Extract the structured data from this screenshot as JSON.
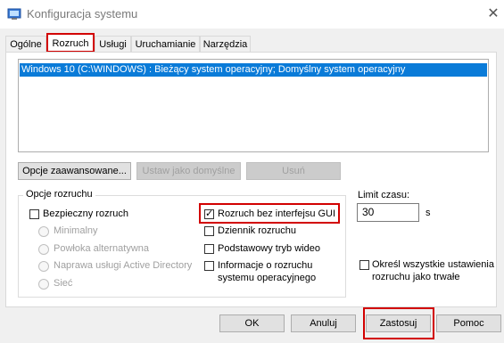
{
  "window": {
    "title": "Konfiguracja systemu"
  },
  "tabs": [
    {
      "label": "Ogólne"
    },
    {
      "label": "Rozruch"
    },
    {
      "label": "Usługi"
    },
    {
      "label": "Uruchamianie"
    },
    {
      "label": "Narzędzia"
    }
  ],
  "os_list": {
    "items": [
      "Windows 10 (C:\\WINDOWS) : Bieżący system operacyjny; Domyślny system operacyjny"
    ]
  },
  "os_buttons": {
    "advanced": "Opcje zaawansowane...",
    "set_default": "Ustaw jako domyślne",
    "delete": "Usuń"
  },
  "boot_options": {
    "group_label": "Opcje rozruchu",
    "safe_boot": "Bezpieczny rozruch",
    "minimal": "Minimalny",
    "alt_shell": "Powłoka alternatywna",
    "ad_repair": "Naprawa usługi Active Directory",
    "network": "Sieć",
    "no_gui": "Rozruch bez interfejsu GUI",
    "boot_log": "Dziennik rozruchu",
    "base_video": "Podstawowy tryb wideo",
    "os_info_line1": "Informacje o rozruchu",
    "os_info_line2": "systemu operacyjnego"
  },
  "timeout": {
    "label": "Limit czasu:",
    "value": "30",
    "unit": "s"
  },
  "permanent": {
    "line1": "Określ wszystkie ustawienia",
    "line2": "rozruchu jako trwałe"
  },
  "footer": {
    "ok": "OK",
    "cancel": "Anuluj",
    "apply": "Zastosuj",
    "help": "Pomoc"
  },
  "colors": {
    "highlight": "#0a7bd8",
    "annotation": "#d20000"
  }
}
